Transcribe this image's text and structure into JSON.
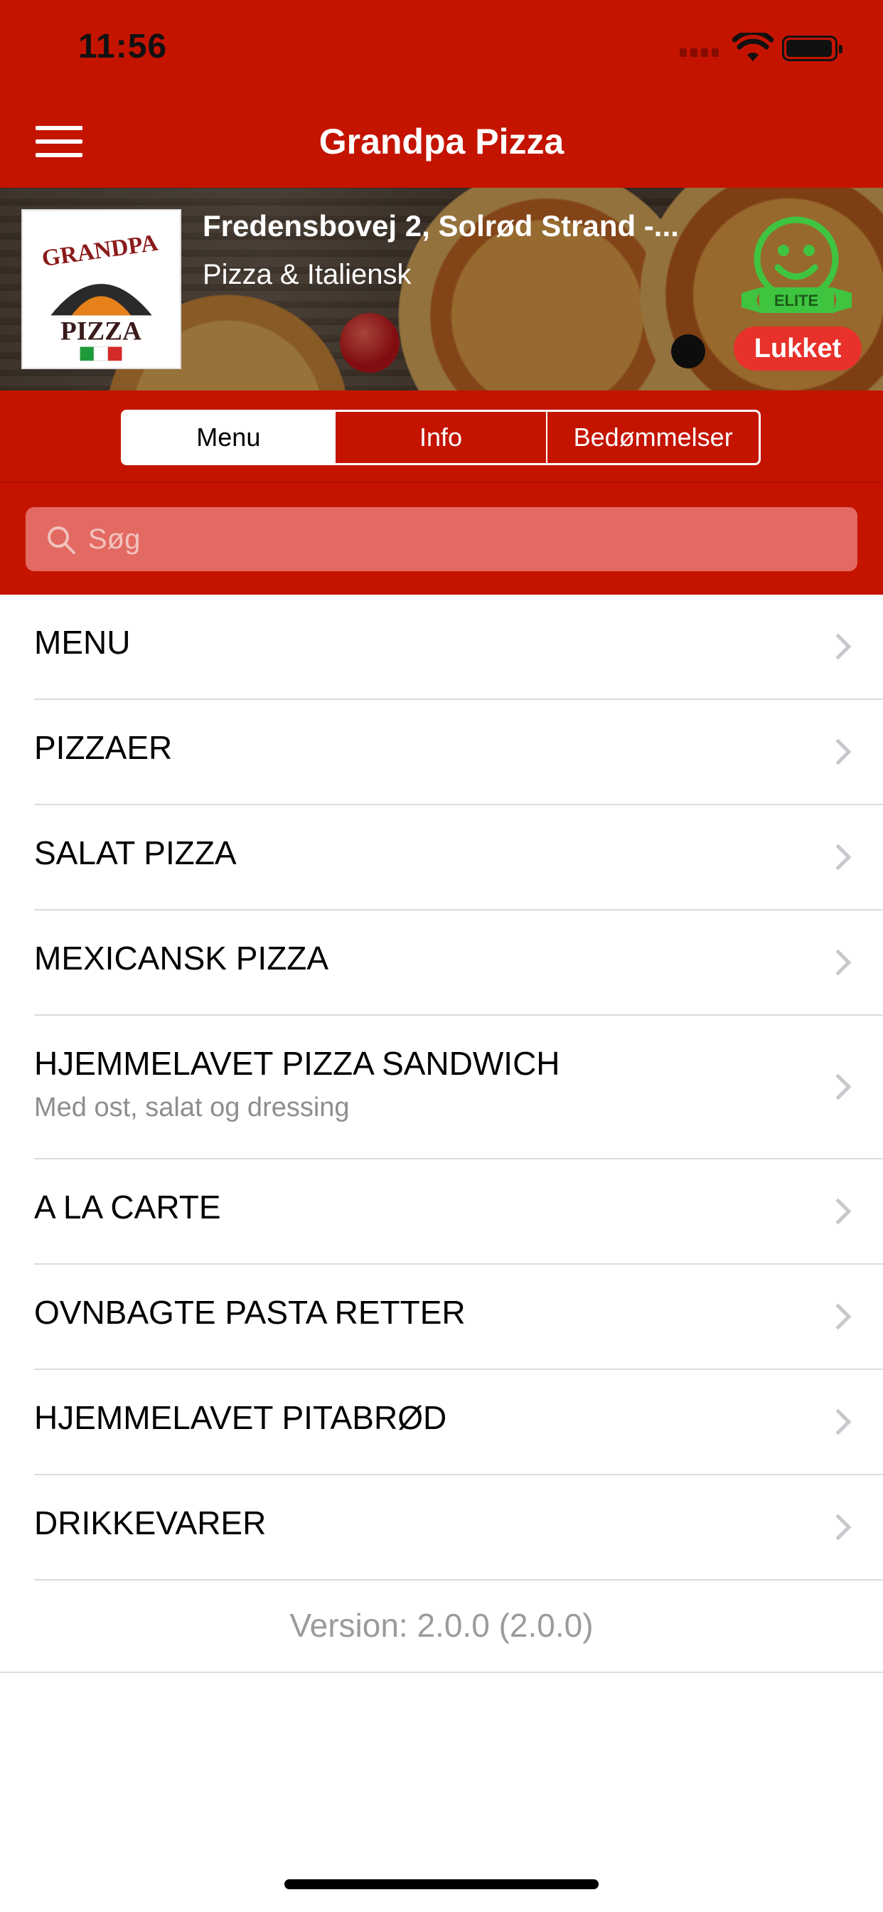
{
  "status_bar": {
    "time": "11:56"
  },
  "nav": {
    "title": "Grandpa Pizza"
  },
  "restaurant": {
    "address": "Fredensbovej 2, Solrød Strand -...",
    "category": "Pizza & Italiensk",
    "logo_text": [
      "GRANDPA",
      "PIZZA"
    ],
    "badge_text": "ELITE",
    "status": "Lukket"
  },
  "tabs": [
    {
      "label": "Menu",
      "active": true
    },
    {
      "label": "Info",
      "active": false
    },
    {
      "label": "Bedømmelser",
      "active": false
    }
  ],
  "search": {
    "placeholder": "Søg"
  },
  "menu_items": [
    {
      "title": "MENU"
    },
    {
      "title": "PIZZAER"
    },
    {
      "title": "SALAT PIZZA"
    },
    {
      "title": "MEXICANSK PIZZA"
    },
    {
      "title": "HJEMMELAVET PIZZA SANDWICH",
      "subtitle": "Med ost, salat og dressing"
    },
    {
      "title": "A LA CARTE"
    },
    {
      "title": "OVNBAGTE PASTA RETTER"
    },
    {
      "title": "HJEMMELAVET PITABRØD"
    },
    {
      "title": "DRIKKEVARER"
    }
  ],
  "footer": {
    "version": "Version: 2.0.0 (2.0.0)"
  },
  "colors": {
    "brand_red": "#c41400",
    "search_bg": "#e36a62",
    "closed_pill": "#e8312b",
    "elite_green": "#3fc43f"
  }
}
